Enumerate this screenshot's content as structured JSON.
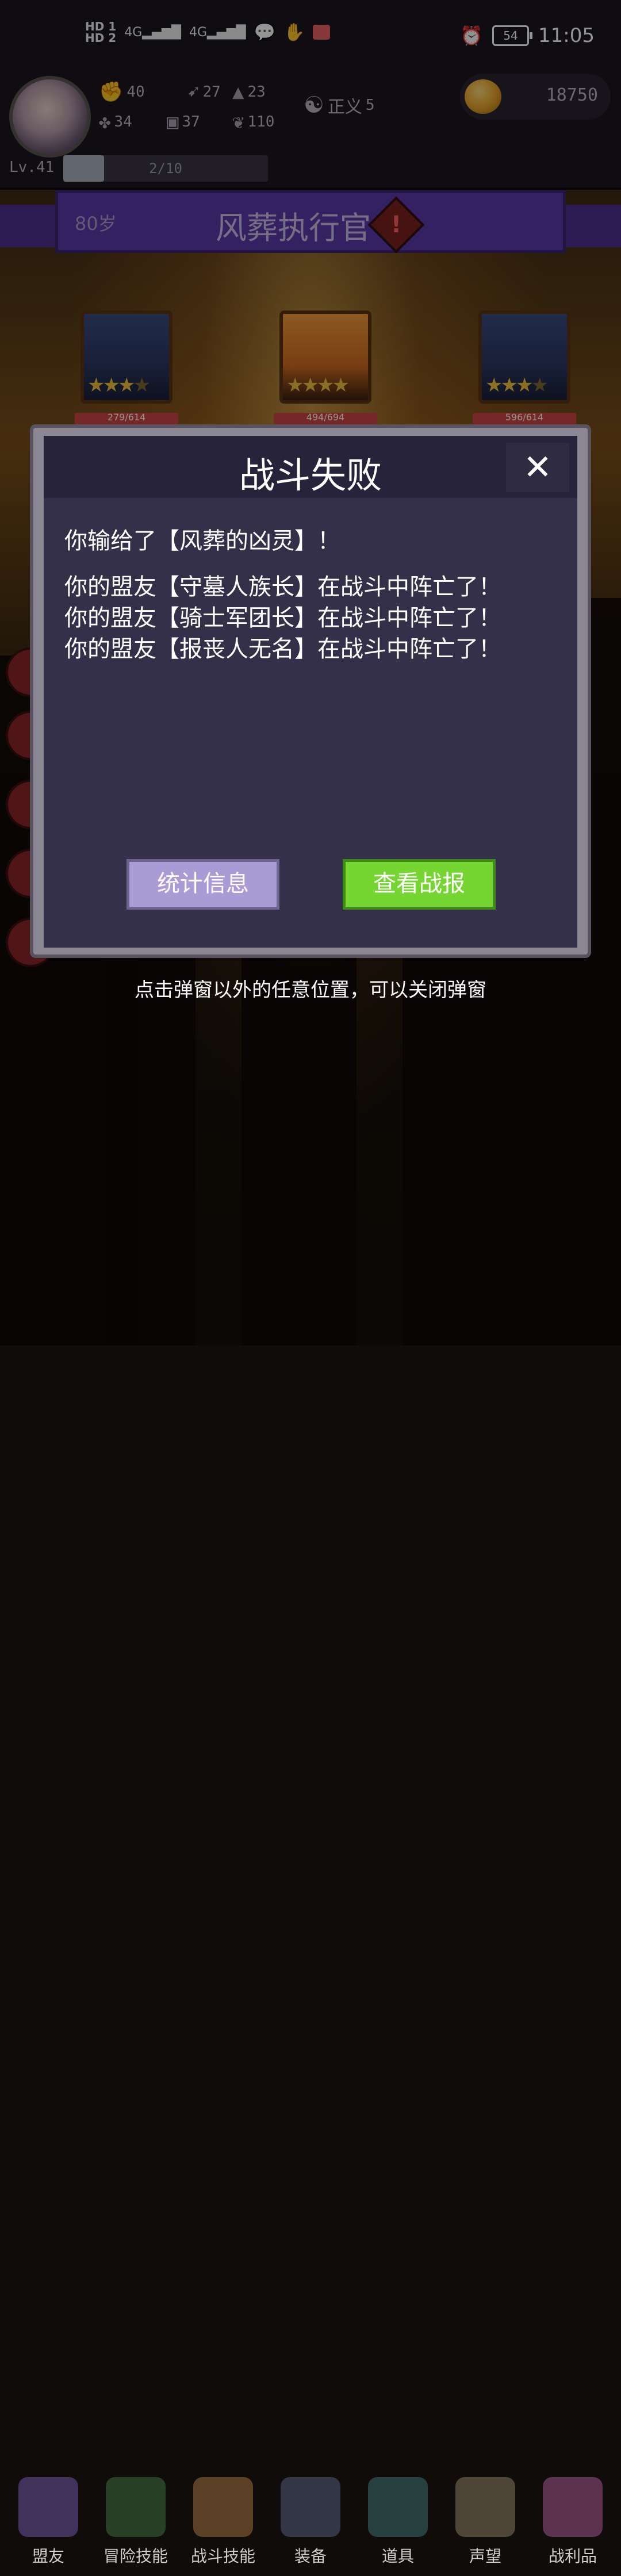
{
  "status_bar": {
    "left_icons": [
      "hd1-icon",
      "hd2-icon",
      "signal-4g-icon",
      "signal-4g-icon",
      "wechat-icon",
      "hand-icon",
      "app-icon"
    ],
    "hd_labels": [
      "HD 1",
      "HD 2"
    ],
    "network_labels": [
      "4G",
      "4G"
    ],
    "alarm_icon": "alarm-icon",
    "battery": "54",
    "time": "11:05"
  },
  "header": {
    "stats": [
      {
        "icon": "fist-icon",
        "value": "40"
      },
      {
        "icon": "arrow-icon",
        "value": "27"
      },
      {
        "icon": "hat-icon",
        "value": "23"
      },
      {
        "icon": "clover-icon",
        "value": "34"
      },
      {
        "icon": "armor-icon",
        "value": "37"
      },
      {
        "icon": "wing-icon",
        "value": "110"
      }
    ],
    "justice_label": "正义",
    "justice_value": "5",
    "coins": "18750",
    "level": "Lv.41",
    "xp_text": "2/10",
    "xp_fraction": 0.2
  },
  "ribbon": {
    "age": "80岁",
    "title": "风葬执行官"
  },
  "enemies": [
    {
      "stars": 3,
      "hp": "279/614"
    },
    {
      "stars": 4,
      "hp": "494/694"
    },
    {
      "stars": 3,
      "hp": "596/614"
    }
  ],
  "dialog": {
    "title": "战斗失败",
    "lines": [
      "你输给了【风葬的凶灵】！",
      "你的盟友【守墓人族长】在战斗中阵亡了！",
      "你的盟友【骑士军团长】在战斗中阵亡了！",
      "你的盟友【报丧人无名】在战斗中阵亡了！"
    ],
    "btn_stats": "统计信息",
    "btn_report": "查看战报",
    "close_glyph": "✕"
  },
  "hint": "点击弹窗以外的任意位置，可以关闭弹窗",
  "nav": [
    {
      "label": "盟友",
      "icon": "handshake-icon"
    },
    {
      "label": "冒险技能",
      "icon": "book-icon"
    },
    {
      "label": "战斗技能",
      "icon": "backpack-icon"
    },
    {
      "label": "装备",
      "icon": "shield-icon"
    },
    {
      "label": "道具",
      "icon": "bag-icon"
    },
    {
      "label": "声望",
      "icon": "scroll-icon"
    },
    {
      "label": "战利品",
      "icon": "chest-icon"
    }
  ],
  "colors": {
    "ribbon": "#5b3aa8",
    "stats_button": "#a99bd6",
    "report_button": "#76d631",
    "dialog_body": "#34304a"
  }
}
